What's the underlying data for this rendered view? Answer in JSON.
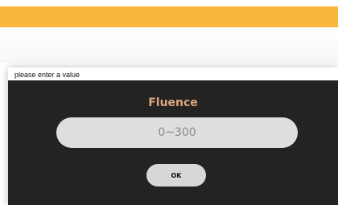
{
  "dialog": {
    "title": "please enter a value",
    "field_label": "Fluence",
    "input_value": "",
    "input_placeholder": "0~300",
    "ok_label": "OK"
  },
  "colors": {
    "top_bar": "#f8b63c",
    "dialog_body": "#232323",
    "field_label": "#e0a57c",
    "input_bg": "#dedede",
    "button_bg": "#d7d7d7"
  }
}
